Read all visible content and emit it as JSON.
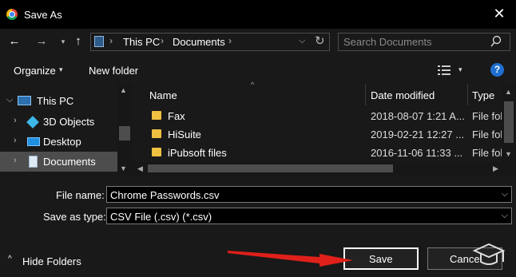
{
  "window": {
    "title": "Save As",
    "close_glyph": "✕",
    "app_icon": "chrome-icon"
  },
  "nav": {
    "back_glyph": "←",
    "forward_glyph": "→",
    "recent_glyph": "▾",
    "up_glyph": "↑"
  },
  "address": {
    "segments": [
      "This PC",
      "Documents"
    ],
    "separator": "›",
    "dropdown_glyph": "⌵",
    "refresh_glyph": "↻"
  },
  "search": {
    "placeholder": "Search Documents",
    "icon": "search-icon"
  },
  "toolbar": {
    "organize_label": "Organize",
    "organize_caret": "▾",
    "new_folder_label": "New folder",
    "view_caret": "▾",
    "help_label": "?"
  },
  "sidebar": {
    "items": [
      {
        "label": "This PC",
        "chevron": "⌵",
        "icon": "pc-icon"
      },
      {
        "label": "3D Objects",
        "chevron": "›",
        "icon": "3d-objects-icon"
      },
      {
        "label": "Desktop",
        "chevron": "›",
        "icon": "desktop-icon"
      },
      {
        "label": "Documents",
        "chevron": "›",
        "icon": "documents-icon",
        "selected": true
      }
    ]
  },
  "files": {
    "sort_caret": "^",
    "columns": [
      "Name",
      "Date modified",
      "Type"
    ],
    "rows": [
      {
        "name": "Fax",
        "date": "2018-08-07 1:21 A...",
        "type": "File fol"
      },
      {
        "name": "HiSuite",
        "date": "2019-02-21 12:27 ...",
        "type": "File fol"
      },
      {
        "name": "iPubsoft files",
        "date": "2016-11-06 11:33 ...",
        "type": "File fol"
      }
    ]
  },
  "scroll": {
    "up": "▲",
    "down": "▼",
    "left": "◀",
    "right": "▶"
  },
  "form": {
    "filename_label": "File name:",
    "filename_value": "Chrome Passwords.csv",
    "savetype_label": "Save as type:",
    "savetype_value": "CSV File (.csv) (*.csv)",
    "caret": "⌵"
  },
  "footer": {
    "hide_folders_label": "Hide Folders",
    "hide_caret": "^",
    "save_label": "Save",
    "cancel_label": "Cancel"
  },
  "colors": {
    "background": "#191919",
    "selected": "#4d4d4d",
    "folder": "#f0c040",
    "help": "#1f6fd0",
    "annotation_arrow": "#e0201a"
  }
}
